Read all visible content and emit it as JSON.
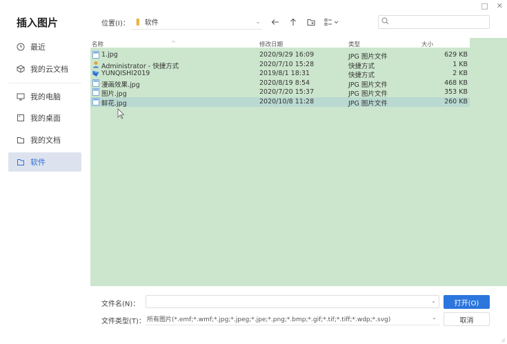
{
  "window": {
    "title": "插入图片",
    "minimize_icon": "□",
    "close_icon": "✕"
  },
  "sidebar": {
    "items": [
      {
        "label": "最近",
        "icon": "clock-icon"
      },
      {
        "label": "我的云文档",
        "icon": "cloud-icon"
      },
      {
        "label": "我的电脑",
        "icon": "computer-icon"
      },
      {
        "label": "我的桌面",
        "icon": "desktop-icon"
      },
      {
        "label": "我的文档",
        "icon": "document-icon"
      },
      {
        "label": "软件",
        "icon": "folder-icon",
        "active": true
      }
    ]
  },
  "toolbar": {
    "location_label": "位置(I)：",
    "location_value": "软件",
    "search_placeholder": ""
  },
  "file_list": {
    "columns": [
      "名称",
      "修改日期",
      "类型",
      "大小"
    ],
    "rows": [
      {
        "name": "1.jpg",
        "date": "2020/9/29 16:09",
        "type": "JPG 图片文件",
        "size": "629 KB",
        "icon": "image-file-icon"
      },
      {
        "name": "Administrator - 快捷方式",
        "date": "2020/7/10 15:28",
        "type": "快捷方式",
        "size": "1 KB",
        "icon": "user-shortcut-icon"
      },
      {
        "name": "YUNQISHI2019",
        "date": "2019/8/1 18:31",
        "type": "快捷方式",
        "size": "2 KB",
        "icon": "app-shortcut-icon"
      },
      {
        "name": "漫画效果.jpg",
        "date": "2020/8/19 8:54",
        "type": "JPG 图片文件",
        "size": "468 KB",
        "icon": "image-file-icon"
      },
      {
        "name": "图片.jpg",
        "date": "2020/7/20 15:37",
        "type": "JPG 图片文件",
        "size": "353 KB",
        "icon": "image-file-icon"
      },
      {
        "name": "鲜花.jpg",
        "date": "2020/10/8 11:28",
        "type": "JPG 图片文件",
        "size": "260 KB",
        "icon": "image-file-icon",
        "selected": true
      }
    ]
  },
  "bottom": {
    "filename_label": "文件名(N)：",
    "filename_value": "",
    "filetype_label": "文件类型(T)：",
    "filetype_value": "所有图片(*.emf;*.wmf;*.jpg;*.jpeg;*.jpe;*.png;*.bmp;*.gif;*.tif;*.tiff;*.wdp;*.svg)",
    "open_button": "打开(O)",
    "cancel_button": "取消"
  },
  "colors": {
    "accent": "#2b75dd",
    "list_bg": "#cce6cd",
    "selected_row": "#b9d9d1",
    "sidebar_active": "#dde3ee"
  }
}
